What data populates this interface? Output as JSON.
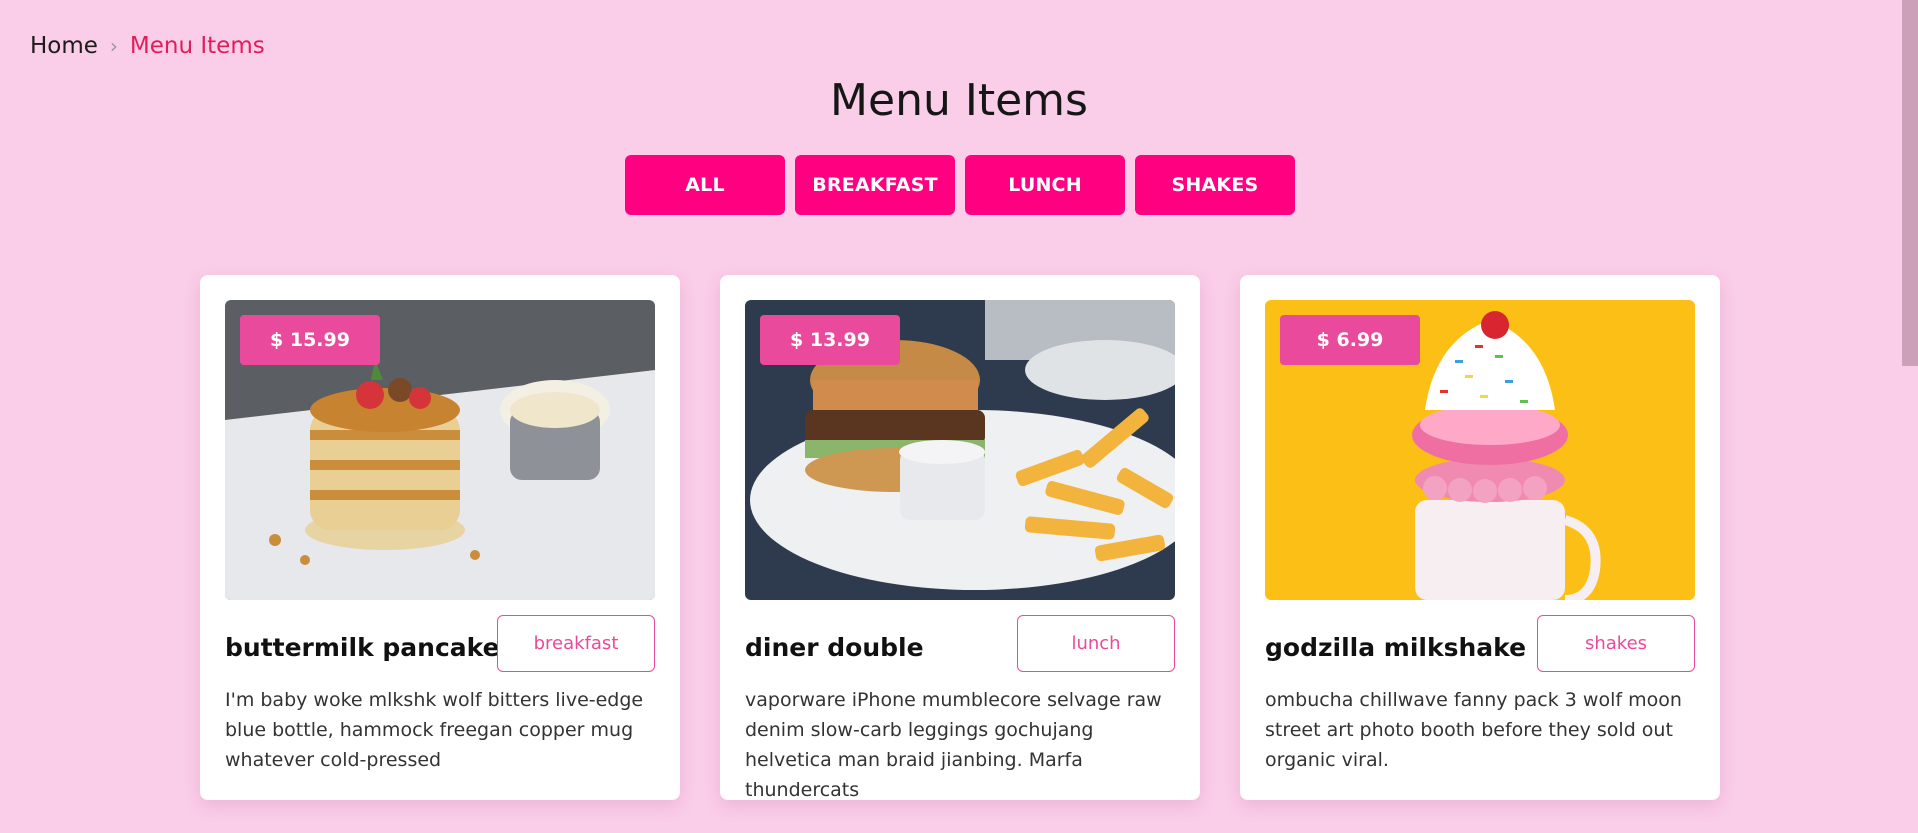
{
  "breadcrumb": {
    "home": "Home",
    "current": "Menu Items"
  },
  "page": {
    "title": "Menu Items"
  },
  "filters": [
    "ALL",
    "BREAKFAST",
    "LUNCH",
    "SHAKES"
  ],
  "colors": {
    "background": "#facde9",
    "accent": "#ff0080",
    "price_badge": "#e94a9b",
    "breadcrumb_current": "#e01e5a"
  },
  "items": [
    {
      "price": "$ 15.99",
      "name": "buttermilk pancakes",
      "category": "breakfast",
      "description": "I'm baby woke mlkshk wolf bitters live-edge blue bottle, hammock freegan copper mug whatever cold-pressed",
      "image": "pancakes-photo"
    },
    {
      "price": "$ 13.99",
      "name": "diner double",
      "category": "lunch",
      "description": "vaporware iPhone mumblecore selvage raw denim slow-carb leggings gochujang helvetica man braid jianbing. Marfa thundercats",
      "image": "burger-photo"
    },
    {
      "price": "$ 6.99",
      "name": "godzilla milkshake",
      "category": "shakes",
      "description": "ombucha chillwave fanny pack 3 wolf moon street art photo booth before they sold out organic viral.",
      "image": "milkshake-photo"
    }
  ]
}
